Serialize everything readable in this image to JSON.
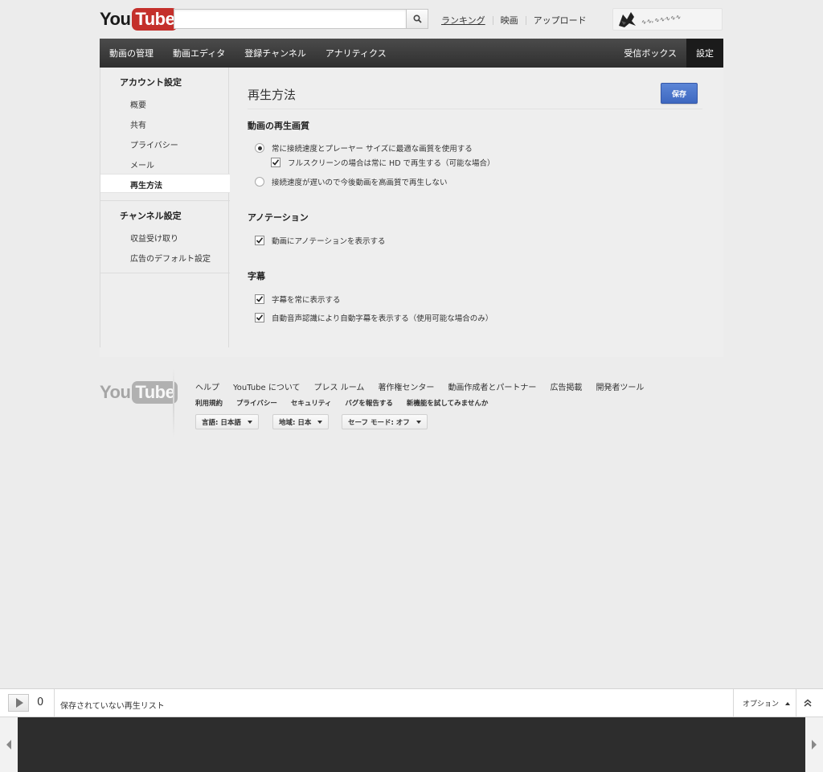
{
  "header": {
    "logo_you": "You",
    "logo_tube": "Tube",
    "search_placeholder": "",
    "links": [
      "ランキング",
      "映画",
      "アップロード"
    ]
  },
  "nav": {
    "left": [
      "動画の管理",
      "動画エディタ",
      "登録チャンネル",
      "アナリティクス"
    ],
    "right": [
      "受信ボックス",
      "設定"
    ],
    "active": "設定"
  },
  "sidebar": {
    "account_title": "アカウント設定",
    "account_items": [
      "概要",
      "共有",
      "プライバシー",
      "メール",
      "再生方法"
    ],
    "active_item": "再生方法",
    "channel_title": "チャンネル設定",
    "channel_items": [
      "収益受け取り",
      "広告のデフォルト設定"
    ]
  },
  "main": {
    "page_title": "再生方法",
    "save_label": "保存",
    "quality": {
      "title": "動画の再生画質",
      "option_best": "常に接続速度とプレーヤー サイズに最適な画質を使用する",
      "option_fullscreen_hd": "フルスクリーンの場合は常に HD で再生する（可能な場合）",
      "option_slow": "接続速度が遅いので今後動画を高画質で再生しない"
    },
    "annotations": {
      "title": "アノテーション",
      "option_show": "動画にアノテーションを表示する"
    },
    "captions": {
      "title": "字幕",
      "option_always": "字幕を常に表示する",
      "option_auto": "自動音声認識により自動字幕を表示する（使用可能な場合のみ）"
    }
  },
  "footer": {
    "logo_you": "You",
    "logo_tube": "Tube",
    "row1": [
      "ヘルプ",
      "YouTube について",
      "プレス ルーム",
      "著作権センター",
      "動画作成者とパートナー",
      "広告掲載",
      "開発者ツール"
    ],
    "row2": [
      "利用規約",
      "プライバシー",
      "セキュリティ",
      "バグを報告する",
      "新機能を試してみませんか"
    ],
    "language": "言語: 日本語",
    "location": "地域: 日本",
    "safety": "セーフ モード: オフ"
  },
  "playlist": {
    "count": "0",
    "title": "保存されていない再生リスト",
    "options_label": "オプション"
  },
  "colors": {
    "accent_red": "#c4302b",
    "save_blue": "#4a74cc",
    "nav_dark": "#3a3a3a"
  }
}
